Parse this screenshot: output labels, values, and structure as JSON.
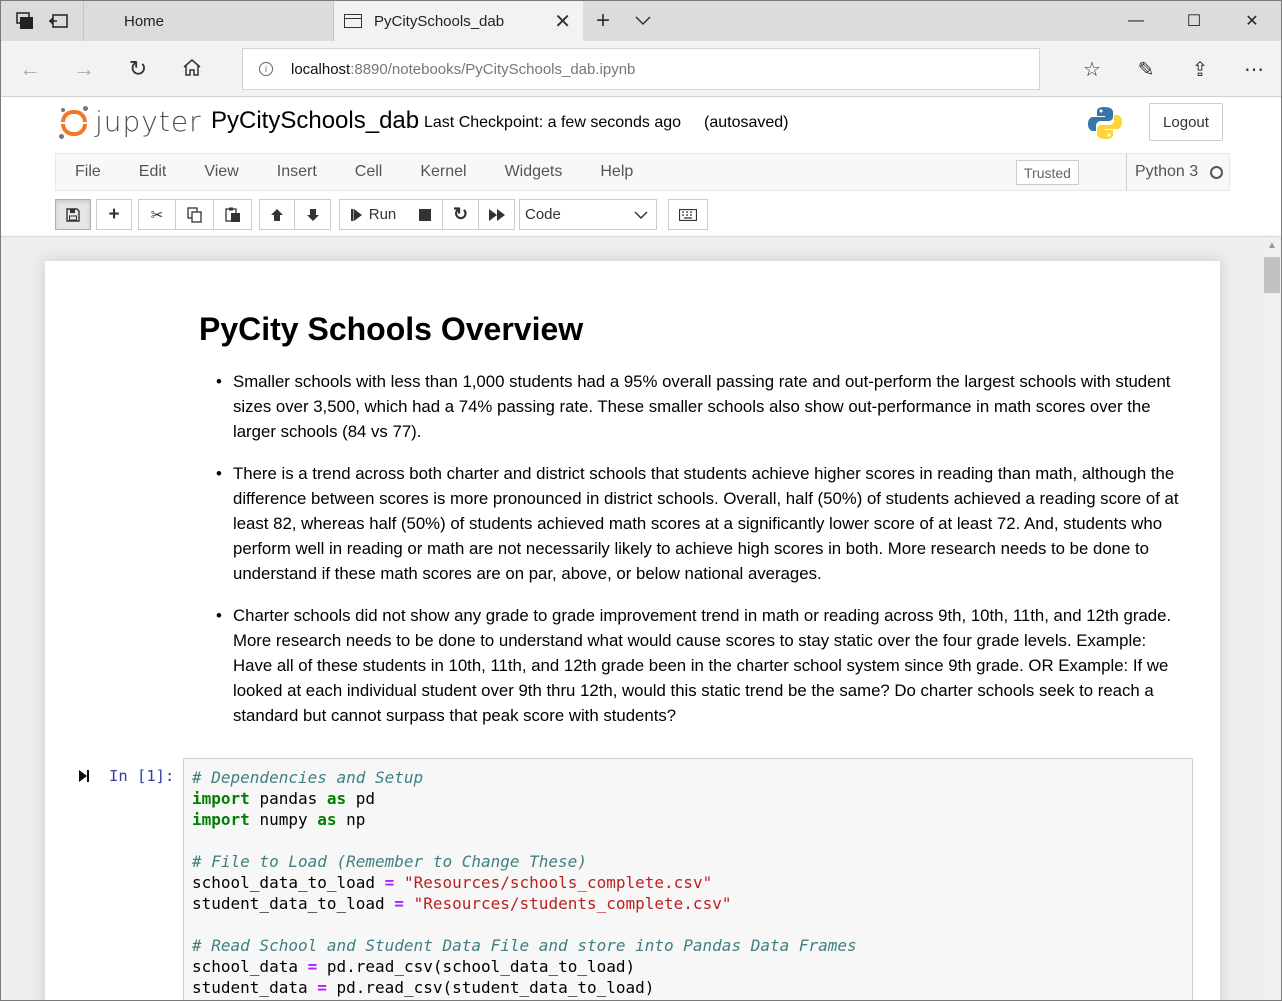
{
  "browser": {
    "tabs": [
      {
        "label": "Home"
      },
      {
        "label": "PyCitySchools_dab"
      }
    ],
    "url_host": "localhost",
    "url_rest": ":8890/notebooks/PyCitySchools_dab.ipynb"
  },
  "jupyter": {
    "logo_text": "jupyter",
    "notebook_name": "PyCitySchools_dab",
    "checkpoint": "Last Checkpoint: a few seconds ago",
    "autosave": "(autosaved)",
    "logout": "Logout",
    "menu": [
      "File",
      "Edit",
      "View",
      "Insert",
      "Cell",
      "Kernel",
      "Widgets",
      "Help"
    ],
    "trusted": "Trusted",
    "kernel": "Python 3",
    "toolbar": {
      "run_label": "Run",
      "cell_type": "Code"
    }
  },
  "notebook": {
    "heading": "PyCity Schools Overview",
    "bullets": [
      "Smaller schools with less than 1,000 students had a 95% overall passing rate and out-perform the largest schools with student sizes over 3,500, which had a 74% passing rate. These smaller schools also show out-performance in math scores over the larger schools (84 vs 77).",
      "There is a trend across both charter and district schools that students achieve higher scores in reading than math, although the difference between scores is more pronounced in district schools. Overall, half (50%) of students achieved a reading score of at least 82, whereas half (50%) of students achieved math scores at a significantly lower score of at least 72. And, students who perform well in reading or math are not necessarily likely to achieve high scores in both. More research needs to be done to understand if these math scores are on par, above, or below national averages.",
      "Charter schools did not show any grade to grade improvement trend in math or reading across 9th, 10th, 11th, and 12th grade. More research needs to be done to understand what would cause scores to stay static over the four grade levels. Example: Have all of these students in 10th, 11th, and 12th grade been in the charter school system since 9th grade. OR Example: If we looked at each individual student over 9th thru 12th, would this static trend be the same? Do charter schools seek to reach a standard but cannot surpass that peak score with students?"
    ],
    "code_prompt": "In [1]:",
    "code": {
      "comment1": "# Dependencies and Setup",
      "import_kw": "import",
      "as_kw": "as",
      "mod_pandas": "pandas",
      "alias_pd": "pd",
      "mod_numpy": "numpy",
      "alias_np": "np",
      "comment2": "# File to Load (Remember to Change These)",
      "var_school_path": "school_data_to_load",
      "var_student_path": "student_data_to_load",
      "assign": "=",
      "str_school": "\"Resources/schools_complete.csv\"",
      "str_student": "\"Resources/students_complete.csv\"",
      "comment3": "# Read School and Student Data File and store into Pandas Data Frames",
      "var_school_data": "school_data",
      "var_student_data": "student_data",
      "call_school": "pd.read_csv(school_data_to_load)",
      "call_student": "pd.read_csv(student_data_to_load)"
    }
  }
}
